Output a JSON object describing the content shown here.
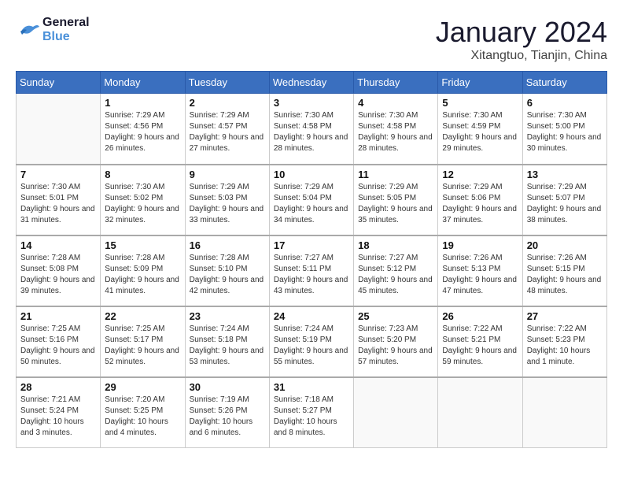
{
  "header": {
    "logo_line1": "General",
    "logo_line2": "Blue",
    "month_title": "January 2024",
    "location": "Xitangtuo, Tianjin, China"
  },
  "weekdays": [
    "Sunday",
    "Monday",
    "Tuesday",
    "Wednesday",
    "Thursday",
    "Friday",
    "Saturday"
  ],
  "weeks": [
    [
      null,
      {
        "date": "1",
        "sunrise": "7:29 AM",
        "sunset": "4:56 PM",
        "daylight": "9 hours and 26 minutes."
      },
      {
        "date": "2",
        "sunrise": "7:29 AM",
        "sunset": "4:57 PM",
        "daylight": "9 hours and 27 minutes."
      },
      {
        "date": "3",
        "sunrise": "7:30 AM",
        "sunset": "4:58 PM",
        "daylight": "9 hours and 28 minutes."
      },
      {
        "date": "4",
        "sunrise": "7:30 AM",
        "sunset": "4:58 PM",
        "daylight": "9 hours and 28 minutes."
      },
      {
        "date": "5",
        "sunrise": "7:30 AM",
        "sunset": "4:59 PM",
        "daylight": "9 hours and 29 minutes."
      },
      {
        "date": "6",
        "sunrise": "7:30 AM",
        "sunset": "5:00 PM",
        "daylight": "9 hours and 30 minutes."
      }
    ],
    [
      {
        "date": "7",
        "sunrise": "7:30 AM",
        "sunset": "5:01 PM",
        "daylight": "9 hours and 31 minutes."
      },
      {
        "date": "8",
        "sunrise": "7:30 AM",
        "sunset": "5:02 PM",
        "daylight": "9 hours and 32 minutes."
      },
      {
        "date": "9",
        "sunrise": "7:29 AM",
        "sunset": "5:03 PM",
        "daylight": "9 hours and 33 minutes."
      },
      {
        "date": "10",
        "sunrise": "7:29 AM",
        "sunset": "5:04 PM",
        "daylight": "9 hours and 34 minutes."
      },
      {
        "date": "11",
        "sunrise": "7:29 AM",
        "sunset": "5:05 PM",
        "daylight": "9 hours and 35 minutes."
      },
      {
        "date": "12",
        "sunrise": "7:29 AM",
        "sunset": "5:06 PM",
        "daylight": "9 hours and 37 minutes."
      },
      {
        "date": "13",
        "sunrise": "7:29 AM",
        "sunset": "5:07 PM",
        "daylight": "9 hours and 38 minutes."
      }
    ],
    [
      {
        "date": "14",
        "sunrise": "7:28 AM",
        "sunset": "5:08 PM",
        "daylight": "9 hours and 39 minutes."
      },
      {
        "date": "15",
        "sunrise": "7:28 AM",
        "sunset": "5:09 PM",
        "daylight": "9 hours and 41 minutes."
      },
      {
        "date": "16",
        "sunrise": "7:28 AM",
        "sunset": "5:10 PM",
        "daylight": "9 hours and 42 minutes."
      },
      {
        "date": "17",
        "sunrise": "7:27 AM",
        "sunset": "5:11 PM",
        "daylight": "9 hours and 43 minutes."
      },
      {
        "date": "18",
        "sunrise": "7:27 AM",
        "sunset": "5:12 PM",
        "daylight": "9 hours and 45 minutes."
      },
      {
        "date": "19",
        "sunrise": "7:26 AM",
        "sunset": "5:13 PM",
        "daylight": "9 hours and 47 minutes."
      },
      {
        "date": "20",
        "sunrise": "7:26 AM",
        "sunset": "5:15 PM",
        "daylight": "9 hours and 48 minutes."
      }
    ],
    [
      {
        "date": "21",
        "sunrise": "7:25 AM",
        "sunset": "5:16 PM",
        "daylight": "9 hours and 50 minutes."
      },
      {
        "date": "22",
        "sunrise": "7:25 AM",
        "sunset": "5:17 PM",
        "daylight": "9 hours and 52 minutes."
      },
      {
        "date": "23",
        "sunrise": "7:24 AM",
        "sunset": "5:18 PM",
        "daylight": "9 hours and 53 minutes."
      },
      {
        "date": "24",
        "sunrise": "7:24 AM",
        "sunset": "5:19 PM",
        "daylight": "9 hours and 55 minutes."
      },
      {
        "date": "25",
        "sunrise": "7:23 AM",
        "sunset": "5:20 PM",
        "daylight": "9 hours and 57 minutes."
      },
      {
        "date": "26",
        "sunrise": "7:22 AM",
        "sunset": "5:21 PM",
        "daylight": "9 hours and 59 minutes."
      },
      {
        "date": "27",
        "sunrise": "7:22 AM",
        "sunset": "5:23 PM",
        "daylight": "10 hours and 1 minute."
      }
    ],
    [
      {
        "date": "28",
        "sunrise": "7:21 AM",
        "sunset": "5:24 PM",
        "daylight": "10 hours and 3 minutes."
      },
      {
        "date": "29",
        "sunrise": "7:20 AM",
        "sunset": "5:25 PM",
        "daylight": "10 hours and 4 minutes."
      },
      {
        "date": "30",
        "sunrise": "7:19 AM",
        "sunset": "5:26 PM",
        "daylight": "10 hours and 6 minutes."
      },
      {
        "date": "31",
        "sunrise": "7:18 AM",
        "sunset": "5:27 PM",
        "daylight": "10 hours and 8 minutes."
      },
      null,
      null,
      null
    ]
  ]
}
